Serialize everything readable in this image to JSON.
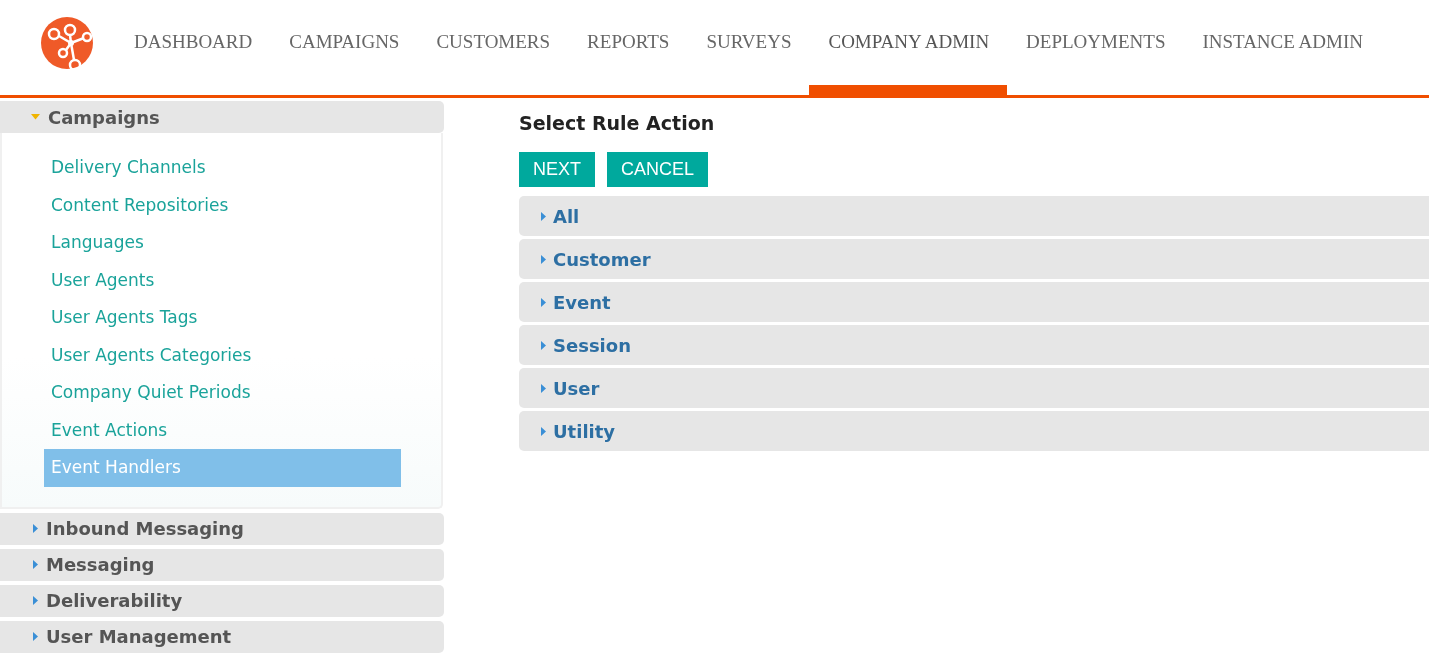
{
  "nav_tabs": [
    {
      "label": "DASHBOARD",
      "selected": false
    },
    {
      "label": "CAMPAIGNS",
      "selected": false
    },
    {
      "label": "CUSTOMERS",
      "selected": false
    },
    {
      "label": "REPORTS",
      "selected": false
    },
    {
      "label": "SURVEYS",
      "selected": false
    },
    {
      "label": "COMPANY ADMIN",
      "selected": true
    },
    {
      "label": "DEPLOYMENTS",
      "selected": false
    },
    {
      "label": "INSTANCE ADMIN",
      "selected": false
    }
  ],
  "sidebar": {
    "sections": [
      {
        "title": "Campaigns",
        "expanded": true,
        "items": [
          {
            "label": "Delivery Channels",
            "selected": false
          },
          {
            "label": "Content Repositories",
            "selected": false
          },
          {
            "label": "Languages",
            "selected": false
          },
          {
            "label": "User Agents",
            "selected": false
          },
          {
            "label": "User Agents Tags",
            "selected": false
          },
          {
            "label": "User Agents Categories",
            "selected": false
          },
          {
            "label": "Company Quiet Periods",
            "selected": false
          },
          {
            "label": "Event Actions",
            "selected": false
          },
          {
            "label": "Event Handlers",
            "selected": true
          }
        ]
      },
      {
        "title": "Inbound Messaging",
        "expanded": false
      },
      {
        "title": "Messaging",
        "expanded": false
      },
      {
        "title": "Deliverability",
        "expanded": false
      },
      {
        "title": "User Management",
        "expanded": false
      }
    ]
  },
  "main": {
    "title": "Select Rule Action",
    "buttons": [
      "NEXT",
      "CANCEL"
    ],
    "groups": [
      {
        "label": "All",
        "expanded": false
      },
      {
        "label": "Customer",
        "expanded": false
      },
      {
        "label": "Event",
        "expanded": false
      },
      {
        "label": "Session",
        "expanded": false
      },
      {
        "label": "User",
        "expanded": false
      },
      {
        "label": "Utility",
        "expanded": false
      }
    ]
  }
}
